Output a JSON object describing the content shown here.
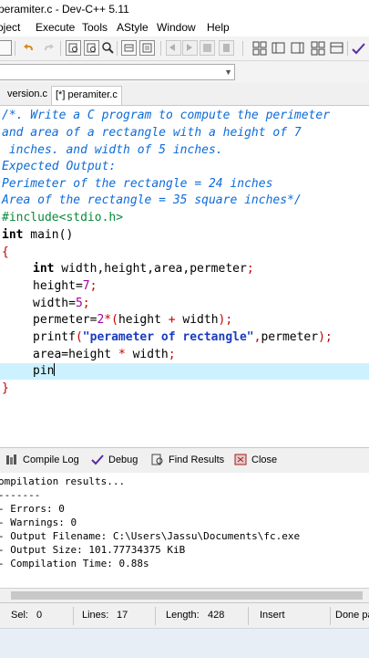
{
  "window": {
    "title": "peramiter.c - Dev-C++ 5.11"
  },
  "menu": [
    "oject",
    "Execute",
    "Tools",
    "AStyle",
    "Window",
    "Help"
  ],
  "tabs": [
    {
      "label": "version.c",
      "active": false
    },
    {
      "label": "[*] peramiter.c",
      "active": true
    }
  ],
  "code": {
    "comment": [
      "/*. Write a C program to compute the perimeter",
      "and area of a rectangle with a height of 7",
      " inches. and width of 5 inches.",
      "Expected Output:",
      "Perimeter of the rectangle = 24 inches",
      "Area of the rectangle = 35 square inches*/"
    ],
    "include": "#include<stdio.h>",
    "int_kw": "int",
    "main_rest": " main()",
    "brace_open": "{",
    "decl_type": "int",
    "decl_vars": " width,height,area,permeter",
    "semi": ";",
    "height_lhs": "height=",
    "height_val": "7",
    "width_lhs": "width=",
    "width_val": "5",
    "perim_lhs": "permeter=",
    "perim_num": "2",
    "perim_star": "*",
    "perim_open": "(",
    "perim_a": "height ",
    "perim_plus": "+",
    "perim_b": " width",
    "perim_close": ")",
    "printf_fn": "printf",
    "printf_open": "(",
    "printf_str": "\"perameter of rectangle\"",
    "printf_comma": ",",
    "printf_arg": "permeter",
    "printf_close": ")",
    "area_lhs": "area=",
    "area_a": "height ",
    "area_star": "*",
    "area_b": " width",
    "typing": "pin",
    "brace_close": "}"
  },
  "panel_tabs": [
    "Compile Log",
    "Debug",
    "Find Results",
    "Close"
  ],
  "compile_log": [
    "ompilation results...",
    "-------",
    "- Errors: 0",
    "- Warnings: 0",
    "- Output Filename: C:\\Users\\Jassu\\Documents\\fc.exe",
    "- Output Size: 101.77734375 KiB",
    "- Compilation Time: 0.88s"
  ],
  "status": {
    "sel_label": "Sel:",
    "sel_value": "0",
    "lines_label": "Lines:",
    "lines_value": "17",
    "length_label": "Length:",
    "length_value": "428",
    "mode": "Insert",
    "message": "Done pa"
  },
  "colors": {
    "comment": "#0c6bd8",
    "preprocessor": "#0a8a3a",
    "string": "#1a3cc0",
    "symbol": "#c00000",
    "number": "#a000a0",
    "current_line": "#ccf2ff"
  }
}
